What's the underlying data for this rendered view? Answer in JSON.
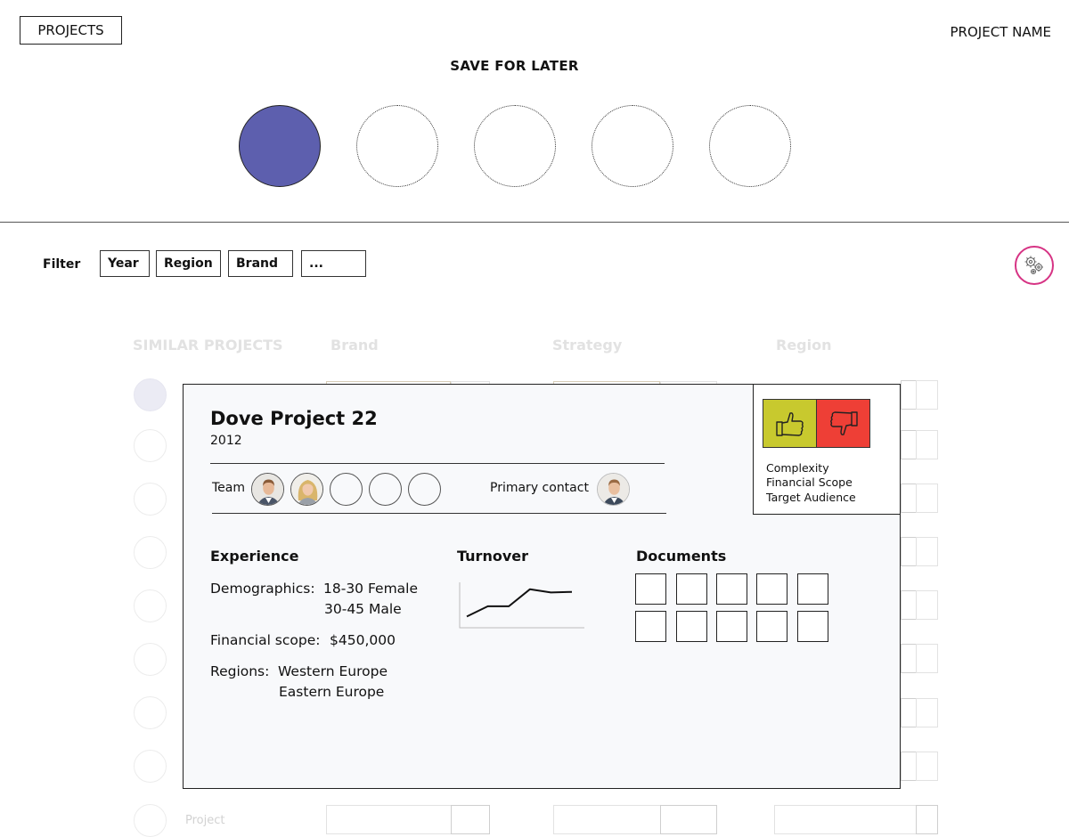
{
  "header": {
    "projects_button": "PROJECTS",
    "project_name": "PROJECT NAME",
    "save_for_later": "SAVE FOR LATER"
  },
  "filter": {
    "label": "Filter",
    "chips": [
      "Year",
      "Region",
      "Brand",
      "..."
    ]
  },
  "background_list": {
    "headers": [
      "SIMILAR PROJECTS",
      "Brand",
      "Strategy",
      "Region"
    ],
    "last_row_label": "Project"
  },
  "card": {
    "title": "Dove Project 22",
    "year": "2012",
    "team_label": "Team",
    "primary_contact_label": "Primary contact",
    "experience": {
      "title": "Experience",
      "demographics_label": "Demographics:",
      "demographics_values": [
        "18-30 Female",
        "30-45 Male"
      ],
      "financial_label": "Financial scope:",
      "financial_value": "$450,000",
      "regions_label": "Regions:",
      "regions_values": [
        "Western Europe",
        "Eastern Europe"
      ]
    },
    "turnover": {
      "title": "Turnover"
    },
    "documents": {
      "title": "Documents"
    },
    "rating": {
      "criteria": [
        "Complexity",
        "Financial Scope",
        "Target Audience"
      ]
    }
  },
  "chart_data": {
    "type": "line",
    "title": "Turnover",
    "series": [
      {
        "values": [
          0.1,
          0.42,
          0.42,
          0.95,
          0.85,
          0.87
        ]
      }
    ]
  },
  "colors": {
    "slot_filled": "#5d5fae",
    "thumbs_up": "#c8c92e",
    "thumbs_down": "#ee3f36",
    "settings_ring": "#d63384"
  }
}
